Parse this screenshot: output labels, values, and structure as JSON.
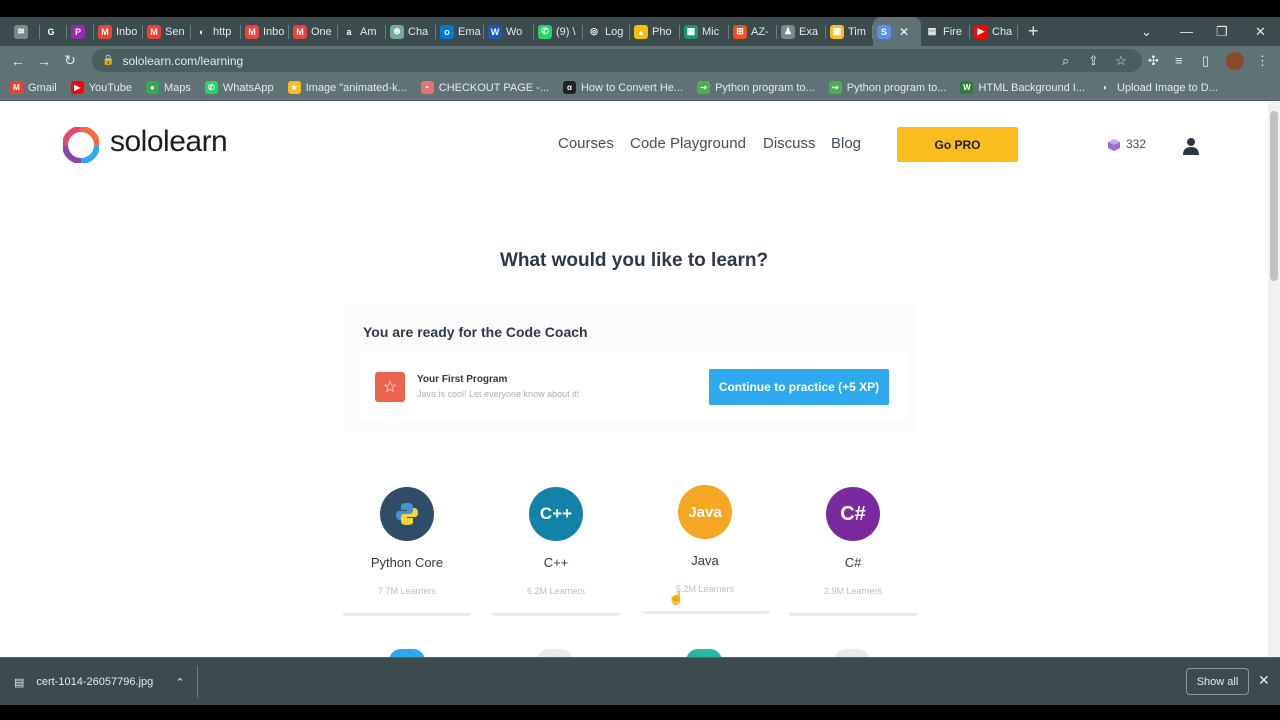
{
  "browser": {
    "tabs": [
      {
        "label": "",
        "color": "#7a8a8c",
        "glyph": "≋"
      },
      {
        "label": "",
        "color": "#ffffff",
        "glyph": "G"
      },
      {
        "label": "",
        "color": "#9c27b0",
        "glyph": "P"
      },
      {
        "label": "Inbo",
        "color": "#ea4335",
        "glyph": "M"
      },
      {
        "label": "Sen",
        "color": "#ea4335",
        "glyph": "M"
      },
      {
        "label": "http",
        "color": "#ffffff",
        "glyph": "◐"
      },
      {
        "label": "Inbo",
        "color": "#ea4335",
        "glyph": "M"
      },
      {
        "label": "One",
        "color": "#ea4335",
        "glyph": "M"
      },
      {
        "label": "Am",
        "color": "#ffffff",
        "glyph": "a"
      },
      {
        "label": "Cha",
        "color": "#74aa9c",
        "glyph": "⊛"
      },
      {
        "label": "Ema",
        "color": "#0078d4",
        "glyph": "o"
      },
      {
        "label": "Wo",
        "color": "#185abd",
        "glyph": "W"
      },
      {
        "label": "(9) \\",
        "color": "#25d366",
        "glyph": "✆"
      },
      {
        "label": "Log",
        "color": "#ffffff",
        "glyph": "◎"
      },
      {
        "label": "Pho",
        "color": "#fbbc04",
        "glyph": "▲"
      },
      {
        "label": "Mic",
        "color": "#1a9a6c",
        "glyph": "▦"
      },
      {
        "label": "AZ-",
        "color": "#f25022",
        "glyph": "⊞"
      },
      {
        "label": "Exa",
        "color": "#7a8a8c",
        "glyph": "♟"
      },
      {
        "label": "Tim",
        "color": "#f9bd1d",
        "glyph": "▣"
      },
      {
        "label": "",
        "color": "#5b8def",
        "glyph": "S",
        "active": true
      },
      {
        "label": "Fire",
        "color": "#ffffff",
        "glyph": "▤"
      },
      {
        "label": "Cha",
        "color": "#ff0000",
        "glyph": "▶"
      }
    ],
    "url": "sololearn.com/learning",
    "bookmarks": [
      {
        "label": "Gmail",
        "color": "#ea4335",
        "glyph": "M"
      },
      {
        "label": "YouTube",
        "color": "#ff0000",
        "glyph": "▶"
      },
      {
        "label": "Maps",
        "color": "#34a853",
        "glyph": "●"
      },
      {
        "label": "WhatsApp",
        "color": "#25d366",
        "glyph": "✆"
      },
      {
        "label": "Image \"animated-k...",
        "color": "#f9bd1d",
        "glyph": "★"
      },
      {
        "label": "CHECKOUT PAGE -...",
        "color": "#e57373",
        "glyph": "◓"
      },
      {
        "label": "How to Convert He...",
        "color": "#222222",
        "glyph": "α"
      },
      {
        "label": "Python program to...",
        "color": "#4caf50",
        "glyph": "⇝"
      },
      {
        "label": "Python program to...",
        "color": "#4caf50",
        "glyph": "⇝"
      },
      {
        "label": "HTML Background I...",
        "color": "#2e7d32",
        "glyph": "W"
      },
      {
        "label": "Upload Image to D...",
        "color": "#ffffff",
        "glyph": "◐"
      }
    ]
  },
  "site": {
    "logo_text": "sololearn",
    "nav": [
      "Courses",
      "Code Playground",
      "Discuss",
      "Blog"
    ],
    "gopro_label": "Go PRO",
    "xp_count": "332",
    "headline": "What would you like to learn?",
    "code_coach": {
      "title": "You are ready for the Code Coach",
      "program_title": "Your First Program",
      "program_subtitle": "Java is cool! Let everyone know about it!",
      "button_label": "Continue to practice (+5 XP)"
    },
    "courses": [
      {
        "name": "Python Core",
        "learners": "7.7M Learners",
        "color": "#2f4d67",
        "glyph": "🐍"
      },
      {
        "name": "C++",
        "learners": "6.2M Learners",
        "color": "#1381a8",
        "glyph": "C++"
      },
      {
        "name": "Java",
        "learners": "5.2M Learners",
        "color": "#f5a623",
        "glyph": "Java"
      },
      {
        "name": "C#",
        "learners": "2.9M Learners",
        "color": "#7a2a9e",
        "glyph": "C#"
      }
    ]
  },
  "downloads": {
    "file_name": "cert-1014-26057796.jpg",
    "show_all_label": "Show all"
  }
}
